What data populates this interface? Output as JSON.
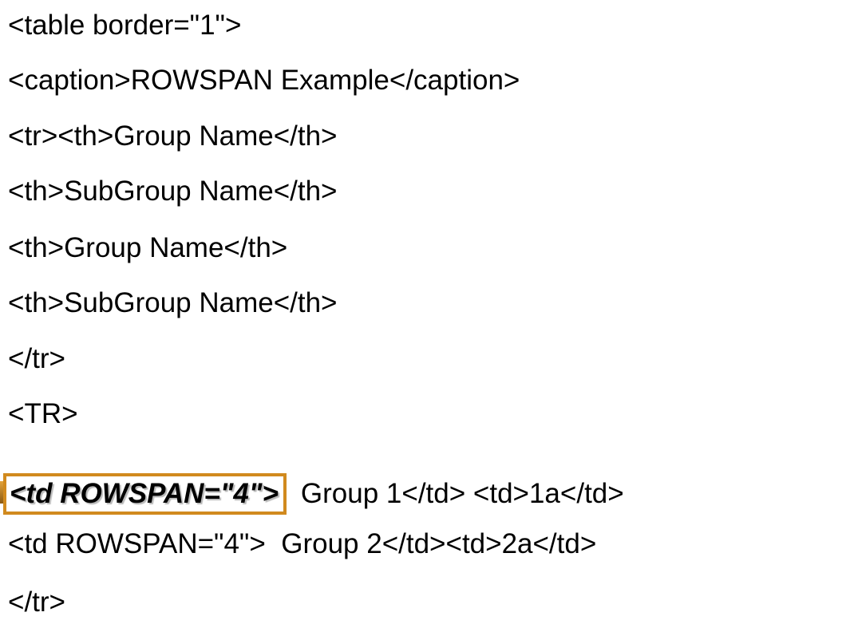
{
  "lines": [
    "<table border=\"1\">",
    "<caption>ROWSPAN Example</caption>",
    "<tr><th>Group Name</th>",
    "<th>SubGroup Name</th>",
    "<th>Group Name</th>",
    "<th>SubGroup Name</th>",
    "</tr>",
    "<TR>",
    "",
    "<td ROWSPAN=\"4\">  Group 2</td><td>2a</td>",
    "</tr>"
  ],
  "highlight_line": {
    "highlighted_text": "<td ROWSPAN=\"4\">",
    "rest": "Group 1</td> <td>1a</td>",
    "highlight_color": "#d18a1e"
  }
}
